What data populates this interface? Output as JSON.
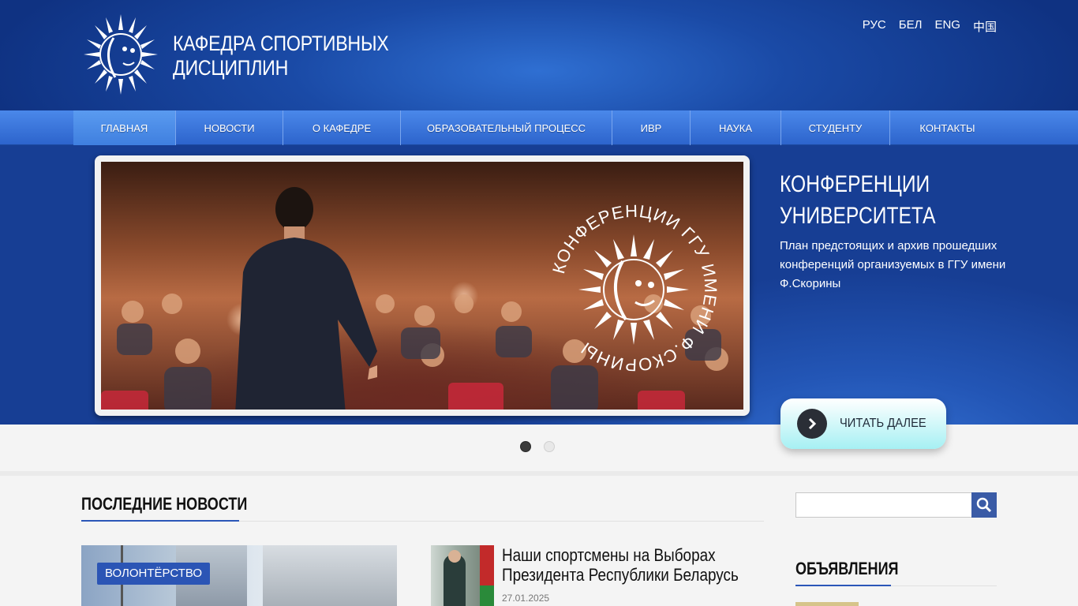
{
  "header": {
    "title_line1": "КАФЕДРА СПОРТИВНЫХ",
    "title_line2": "ДИСЦИПЛИН",
    "logo_icon": "sun-face-logo-icon",
    "languages": [
      "РУС",
      "БЕЛ",
      "ENG",
      "中国"
    ]
  },
  "nav": {
    "items": [
      {
        "label": "ГЛАВНАЯ",
        "active": true
      },
      {
        "label": "НОВОСТИ"
      },
      {
        "label": "О КАФЕДРЕ"
      },
      {
        "label": "ОБРАЗОВАТЕЛЬНЫЙ ПРОЦЕСС"
      },
      {
        "label": "ИВР"
      },
      {
        "label": "НАУКА"
      },
      {
        "label": "СТУДЕНТУ"
      },
      {
        "label": "КОНТАКТЫ"
      }
    ]
  },
  "hero": {
    "title_line1": "КОНФЕРЕНЦИИ",
    "title_line2": "УНИВЕРСИТЕТА",
    "description": "План предстоящих и архив прошедших конференций организуемых в ГГУ имени Ф.Скорины",
    "read_more": "ЧИТАТЬ ДАЛЕЕ",
    "seal_text": "КОНФЕРЕНЦИИ ГГУ ИМЕНИ Ф.СКОРИНЫ",
    "slide_count": 2,
    "active_slide": 1
  },
  "news": {
    "section_title": "ПОСЛЕДНИЕ НОВОСТИ",
    "big_item": {
      "tag": "ВОЛОНТЁРСТВО"
    },
    "item": {
      "headline_line1": "Наши спортсмены на Выборах",
      "headline_line2": "Президента Республики Беларусь",
      "date": "27.01.2025"
    }
  },
  "sidebar": {
    "search_placeholder": "",
    "search_icon": "search-icon",
    "announcements_title": "ОБЪЯВЛЕНИЯ"
  },
  "colors": {
    "header_blue": "#1a4aa6",
    "nav_blue": "#3a76dc",
    "accent_blue": "#2b55b5",
    "read_more_cyan": "#a6f0f3"
  }
}
